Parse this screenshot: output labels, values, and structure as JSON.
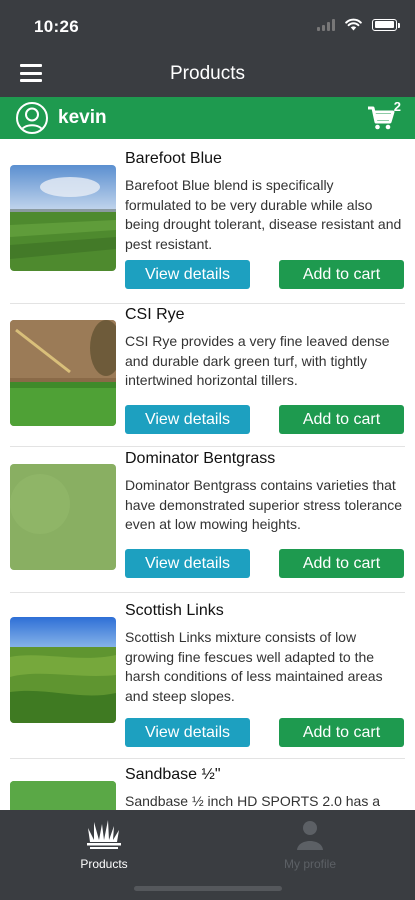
{
  "status_bar": {
    "time": "10:26"
  },
  "header": {
    "title": "Products"
  },
  "user": {
    "name": "kevin",
    "cart_count": "2"
  },
  "colors": {
    "header_bg": "#3a3d41",
    "accent_green": "#1e9a4f",
    "view_button_blue": "#1da0c0"
  },
  "products": [
    {
      "name": "Barefoot Blue",
      "description": "Barefoot Blue blend is specifically formulated to be very durable while also being drought tolerant, disease resistant and pest resistant.",
      "view_label": "View details",
      "add_label": "Add to cart"
    },
    {
      "name": "CSI Rye",
      "description": "CSI Rye provides a very fine leaved dense and durable dark green turf, with tightly intertwined horizontal tillers.",
      "view_label": "View details",
      "add_label": "Add to cart"
    },
    {
      "name": "Dominator Bentgrass",
      "description": "Dominator Bentgrass contains varieties that have demonstrated superior stress tolerance even at low mowing heights.",
      "view_label": "View details",
      "add_label": "Add to cart"
    },
    {
      "name": "Scottish Links",
      "description": "Scottish Links mixture consists of low growing fine fescues well adapted to the harsh conditions of less maintained areas and steep slopes.",
      "view_label": "View details",
      "add_label": "Add to cart"
    },
    {
      "name": "Sandbase ½\"",
      "description": "Sandbase ½ inch HD SPORTS 2.0 has a"
    }
  ],
  "tabs": [
    {
      "label": "Products",
      "icon": "grass-icon",
      "active": true
    },
    {
      "label": "My profile",
      "icon": "person-icon",
      "active": false
    }
  ]
}
